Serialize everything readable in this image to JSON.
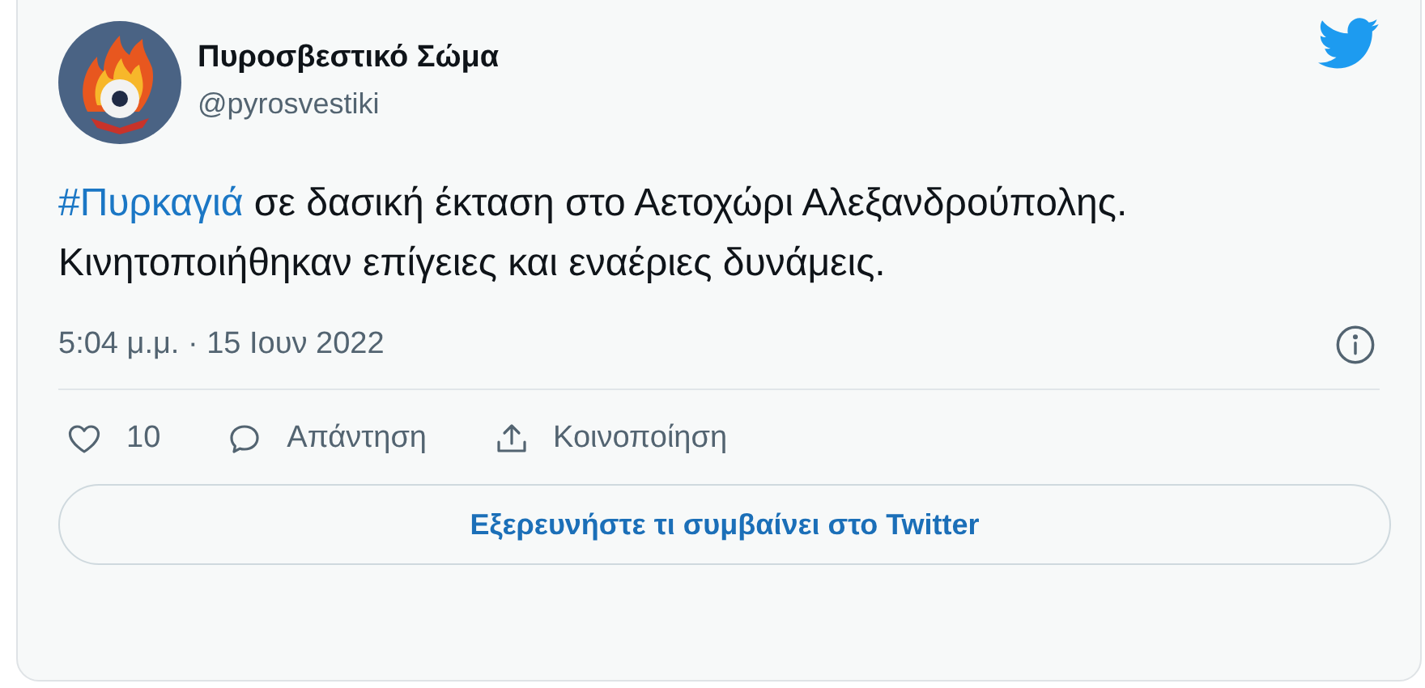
{
  "author": {
    "name": "Πυροσβεστικό Σώμα",
    "handle": "@pyrosvestiki"
  },
  "text_parts": [
    {
      "kind": "hashtag",
      "text": "#Πυρκαγιά"
    },
    {
      "kind": "plain",
      "text": " σε δασική έκταση στο Αετοχώρι Αλεξανδρούπολης. Κινητοποιήθηκαν επίγειες και εναέριες δυνάμεις."
    }
  ],
  "timestamp": "5:04 μ.μ. · 15 Ιουν 2022",
  "actions": [
    {
      "kind": "like",
      "label": "10"
    },
    {
      "kind": "reply",
      "label": "Απάντηση"
    },
    {
      "kind": "share",
      "label": "Κοινοποίηση"
    }
  ],
  "explore_button": "Εξερευνήστε τι συμβαίνει στο Twitter"
}
